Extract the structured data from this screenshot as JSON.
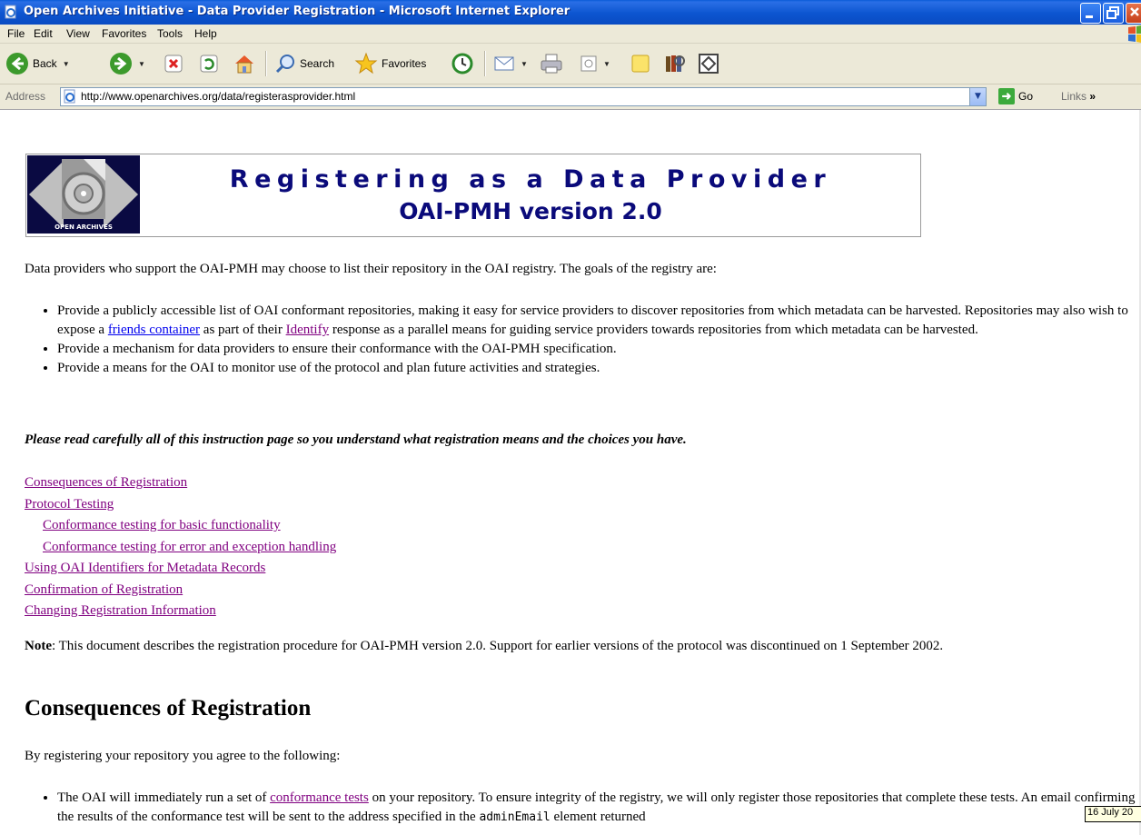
{
  "window": {
    "title": "Open Archives Initiative - Data Provider Registration - Microsoft Internet Explorer"
  },
  "menu": [
    "File",
    "Edit",
    "View",
    "Favorites",
    "Tools",
    "Help"
  ],
  "toolbar": {
    "back": "Back",
    "search": "Search",
    "favorites": "Favorites"
  },
  "address": {
    "label": "Address",
    "url": "http://www.openarchives.org/data/registerasprovider.html",
    "go": "Go",
    "links": "Links"
  },
  "page": {
    "logo_text": "OPEN ARCHIVES",
    "banner_title": "Registering as a Data Provider",
    "banner_subtitle": "OAI-PMH version 2.0",
    "intro": "Data providers who support the OAI-PMH may choose to list their repository in the OAI registry.  The goals of the registry are:",
    "goal1_a": "Provide a publicly accessible list of OAI conformant repositories, making it easy for service providers to discover repositories from which metadata can be harvested. Repositories may also wish to expose a ",
    "goal1_link1": "friends container",
    "goal1_b": " as part of their ",
    "goal1_link2": "Identify",
    "goal1_c": " response as a parallel means for guiding service providers towards repositories from which metadata can be harvested.",
    "goal2": "Provide a mechanism for data providers to ensure their conformance with the OAI-PMH specification.",
    "goal3": "Provide a means for the OAI to monitor use of the protocol and plan future activities and strategies.",
    "warning": "Please read carefully all of this instruction page so you understand what registration means and the choices you have.",
    "toc": [
      "Consequences of Registration",
      "Protocol Testing",
      "Conformance testing for basic functionality",
      "Conformance testing for error and exception handling",
      "Using OAI Identifiers for Metadata Records",
      "Confirmation of Registration",
      "Changing Registration Information"
    ],
    "note_label": "Note",
    "note_text": ": This document describes the registration procedure for OAI-PMH version 2.0. Support for earlier versions of the protocol was discontinued on 1 September 2002.",
    "section_heading": "Consequences of Registration",
    "section_intro": "By registering your repository you agree to the following:",
    "cons1_a": "The OAI will immediately run a set of ",
    "cons1_link": "conformance tests",
    "cons1_b": " on your repository.  To ensure integrity of the registry, we will only register those repositories that complete these tests.  An email confirming the results of the conformance test will be sent to the address specified in the ",
    "cons1_code": "adminEmail",
    "cons1_c": " element returned"
  },
  "tooltip": "16 July 20"
}
